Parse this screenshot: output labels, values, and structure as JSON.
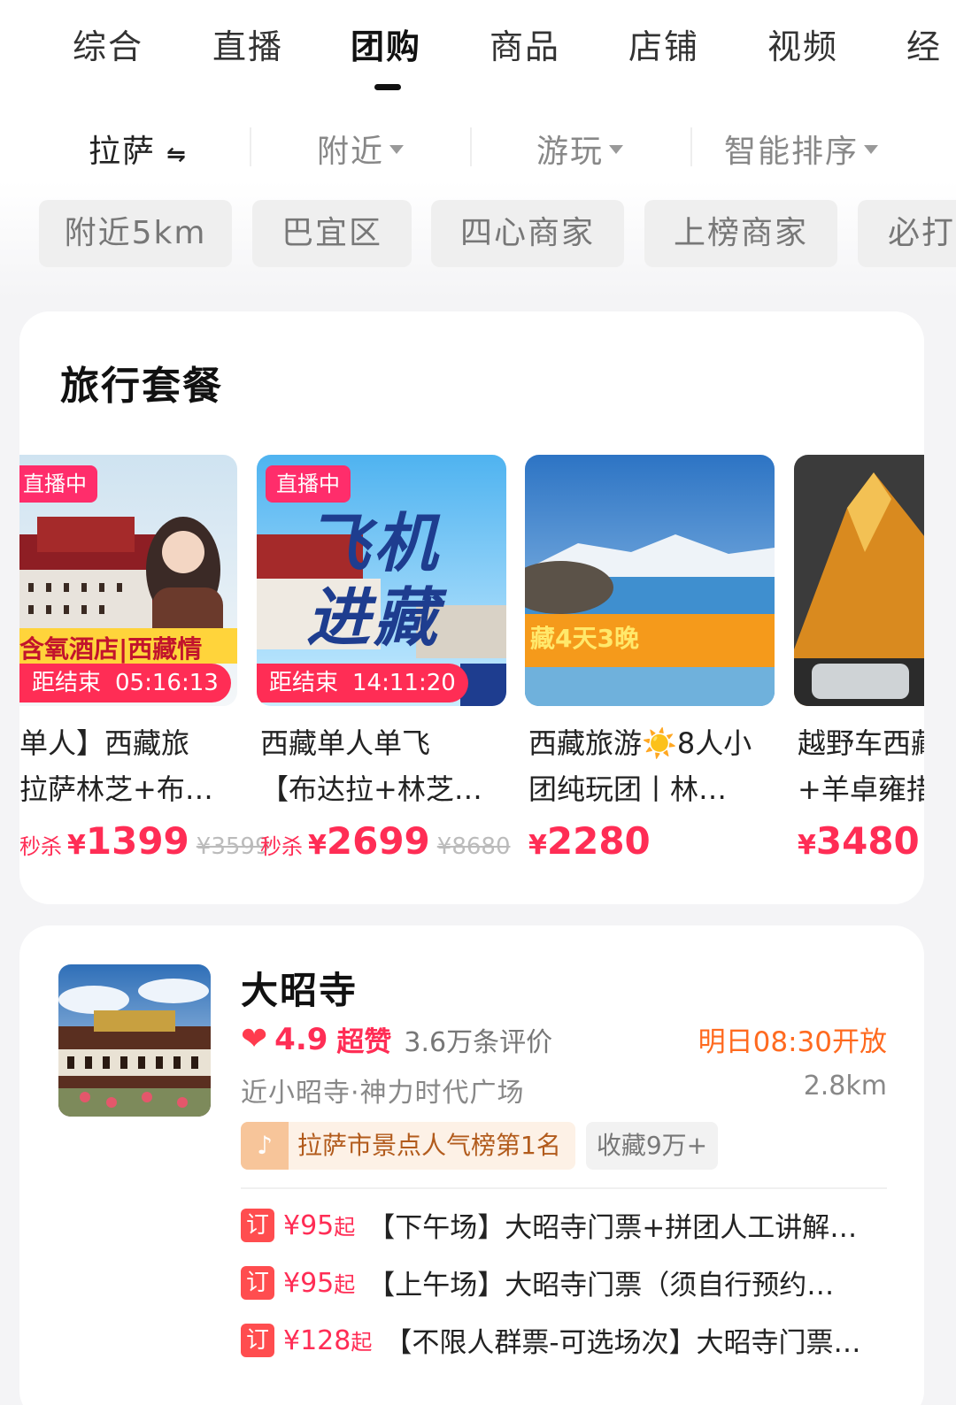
{
  "tabs": [
    "综合",
    "直播",
    "团购",
    "商品",
    "店铺",
    "视频",
    "经"
  ],
  "active_tab": "团购",
  "filters": {
    "city": "拉萨",
    "nearby": "附近",
    "category": "游玩",
    "sort": "智能排序"
  },
  "chips": [
    "附近5km",
    "巴宜区",
    "四心商家",
    "上榜商家",
    "必打"
  ],
  "travel": {
    "title": "旅行套餐",
    "products": [
      {
        "badge": "直播中",
        "timer_label": "距结束",
        "timer": "05:16:13",
        "overlay": "含氧酒店|西藏情",
        "title_line1": "单人】西藏旅",
        "title_line2": "拉萨林芝+布…",
        "flash": "秒杀",
        "price_symbol": "¥",
        "price": "1399",
        "original": "¥3599"
      },
      {
        "badge": "直播中",
        "timer_label": "距结束",
        "timer": "14:11:20",
        "overlay_line1": "飞机",
        "overlay_line2": "进藏",
        "title_line1": "西藏单人单飞",
        "title_line2": "【布达拉+林芝…",
        "flash": "秒杀",
        "price_symbol": "¥",
        "price": "2699",
        "original": "¥8680"
      },
      {
        "overlay": "藏4天3晚",
        "title_line1": "西藏旅游☀️8人小",
        "title_line2": "团纯玩团丨林…",
        "price_symbol": "¥",
        "price": "2280"
      },
      {
        "title_line1": "越野车西藏",
        "title_line2": "+羊卓雍措",
        "price_symbol": "¥",
        "price": "3480",
        "original": "¥"
      }
    ]
  },
  "attraction": {
    "name": "大昭寺",
    "heart_icon": "heart-icon",
    "score": "4.9",
    "praise": "超赞",
    "reviews": "3.6万条评价",
    "open_time": "明日08:30开放",
    "location": "近小昭寺·神力时代广场",
    "distance": "2.8km",
    "rank_tag": "拉萨市景点人气榜第1名",
    "fav_tag": "收藏9万+",
    "deals": [
      {
        "icon": "订",
        "price": "¥95",
        "suffix": "起",
        "title": "【下午场】大昭寺门票+拼团人工讲解…"
      },
      {
        "icon": "订",
        "price": "¥95",
        "suffix": "起",
        "title": "【上午场】大昭寺门票（须自行预约…"
      },
      {
        "icon": "订",
        "price": "¥128",
        "suffix": "起",
        "title": "【不限人群票-可选场次】大昭寺门票…"
      }
    ]
  },
  "colors": {
    "accent": "#ff2d55",
    "open": "#ff6a1f",
    "chip_bg": "#efefef"
  }
}
